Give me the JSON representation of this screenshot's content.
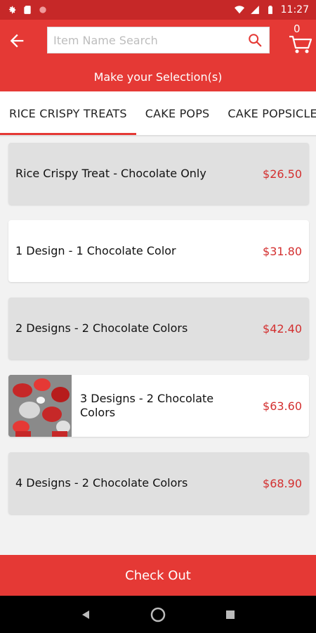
{
  "status_bar": {
    "time": "11:27"
  },
  "search": {
    "placeholder": "Item Name Search"
  },
  "cart": {
    "count": "0"
  },
  "selection_bar": {
    "label": "Make your Selection(s)"
  },
  "tabs": [
    {
      "label": "RICE CRISPY TREATS",
      "active": true
    },
    {
      "label": "CAKE POPS",
      "active": false
    },
    {
      "label": "CAKE POPSICLES",
      "active": false
    }
  ],
  "items": [
    {
      "name": "Rice Crispy Treat - Chocolate Only",
      "price": "$26.50"
    },
    {
      "name": "1 Design - 1 Chocolate Color",
      "price": "$31.80"
    },
    {
      "name": "2 Designs - 2 Chocolate Colors",
      "price": "$42.40"
    },
    {
      "name": "3 Designs - 2 Chocolate Colors",
      "price": "$63.60"
    },
    {
      "name": "4 Designs - 2 Chocolate Colors",
      "price": "$68.90"
    }
  ],
  "checkout": {
    "label": "Check Out"
  },
  "colors": {
    "primary": "#e53935",
    "status": "#c62828",
    "price": "#d32f2f"
  }
}
